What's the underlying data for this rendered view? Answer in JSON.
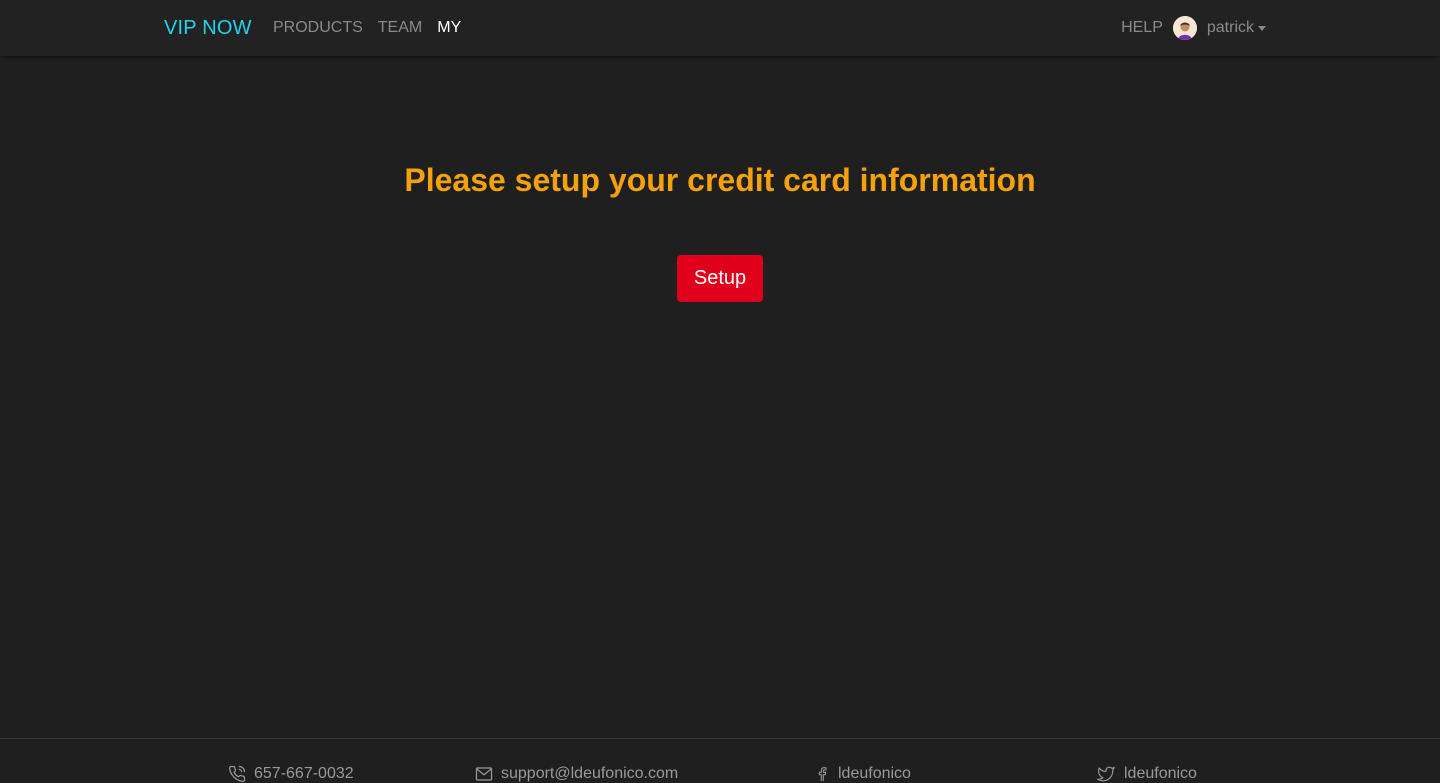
{
  "nav": {
    "brand": "VIP NOW",
    "links": [
      {
        "label": "PRODUCTS",
        "active": false
      },
      {
        "label": "TEAM",
        "active": false
      },
      {
        "label": "MY",
        "active": true
      }
    ],
    "help": "HELP",
    "user": "patrick"
  },
  "main": {
    "headline": "Please setup your credit card information",
    "setup_button": "Setup"
  },
  "footer": {
    "phone": "657-667-0032",
    "email": "support@ldeufonico.com",
    "facebook": "ldeufonico",
    "twitter": "ldeufonico"
  },
  "colors": {
    "brand": "#22d3ee",
    "headline": "#f5a20a",
    "button": "#e0001b",
    "background": "#1f1f1f"
  }
}
